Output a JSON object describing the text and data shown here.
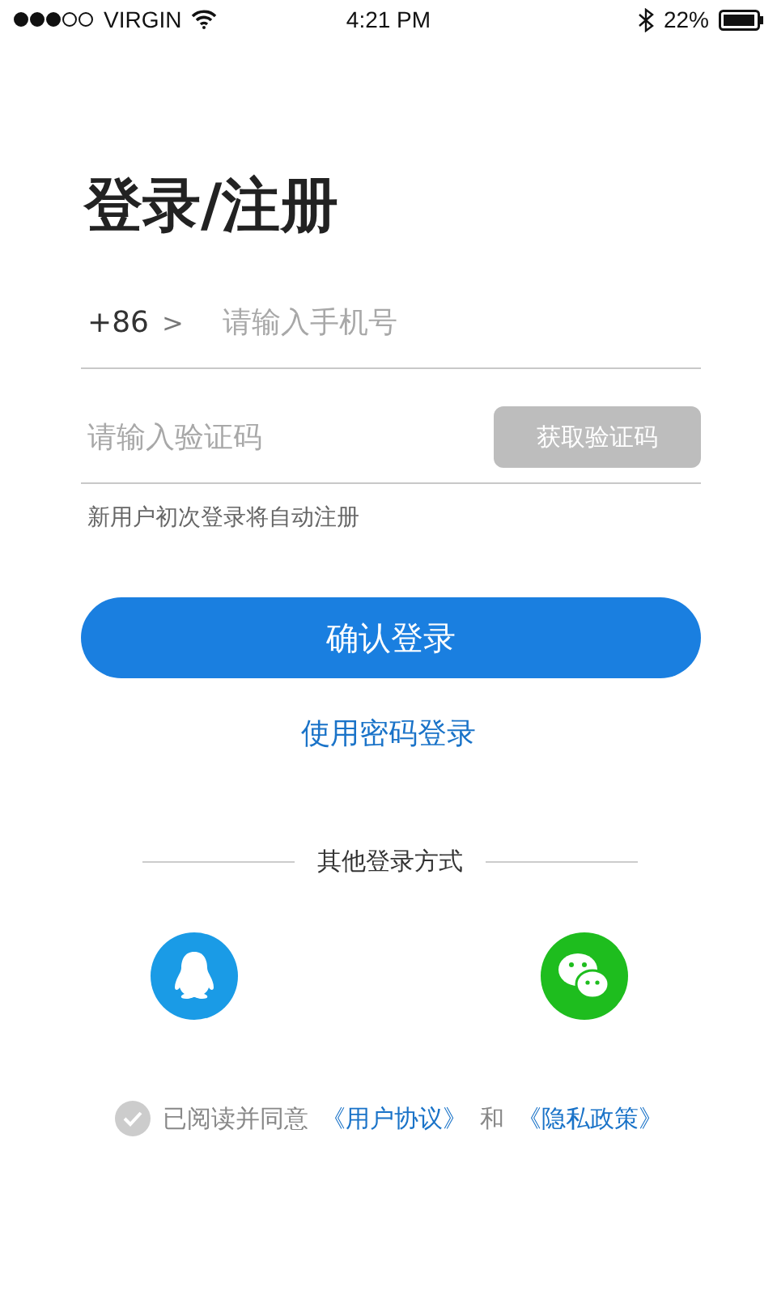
{
  "status_bar": {
    "carrier": "VIRGIN",
    "time": "4:21  PM",
    "battery": "22%"
  },
  "title": "登录/注册",
  "phone": {
    "country_code": "+86",
    "chevron": ">",
    "placeholder": "请输入手机号"
  },
  "code": {
    "placeholder": "请输入验证码",
    "button": {
      "label": "获取验证码",
      "disabled": true
    }
  },
  "hint": "新用户初次登录将自动注册",
  "submit": "确认登录",
  "password_login": "使用密码登录",
  "other_methods": "其他登录方式",
  "agreement": {
    "checked": false,
    "text": "已阅读并同意",
    "link_1": "《用户协议》",
    "joiner": "和",
    "link_2": "《隐私政策》"
  }
}
